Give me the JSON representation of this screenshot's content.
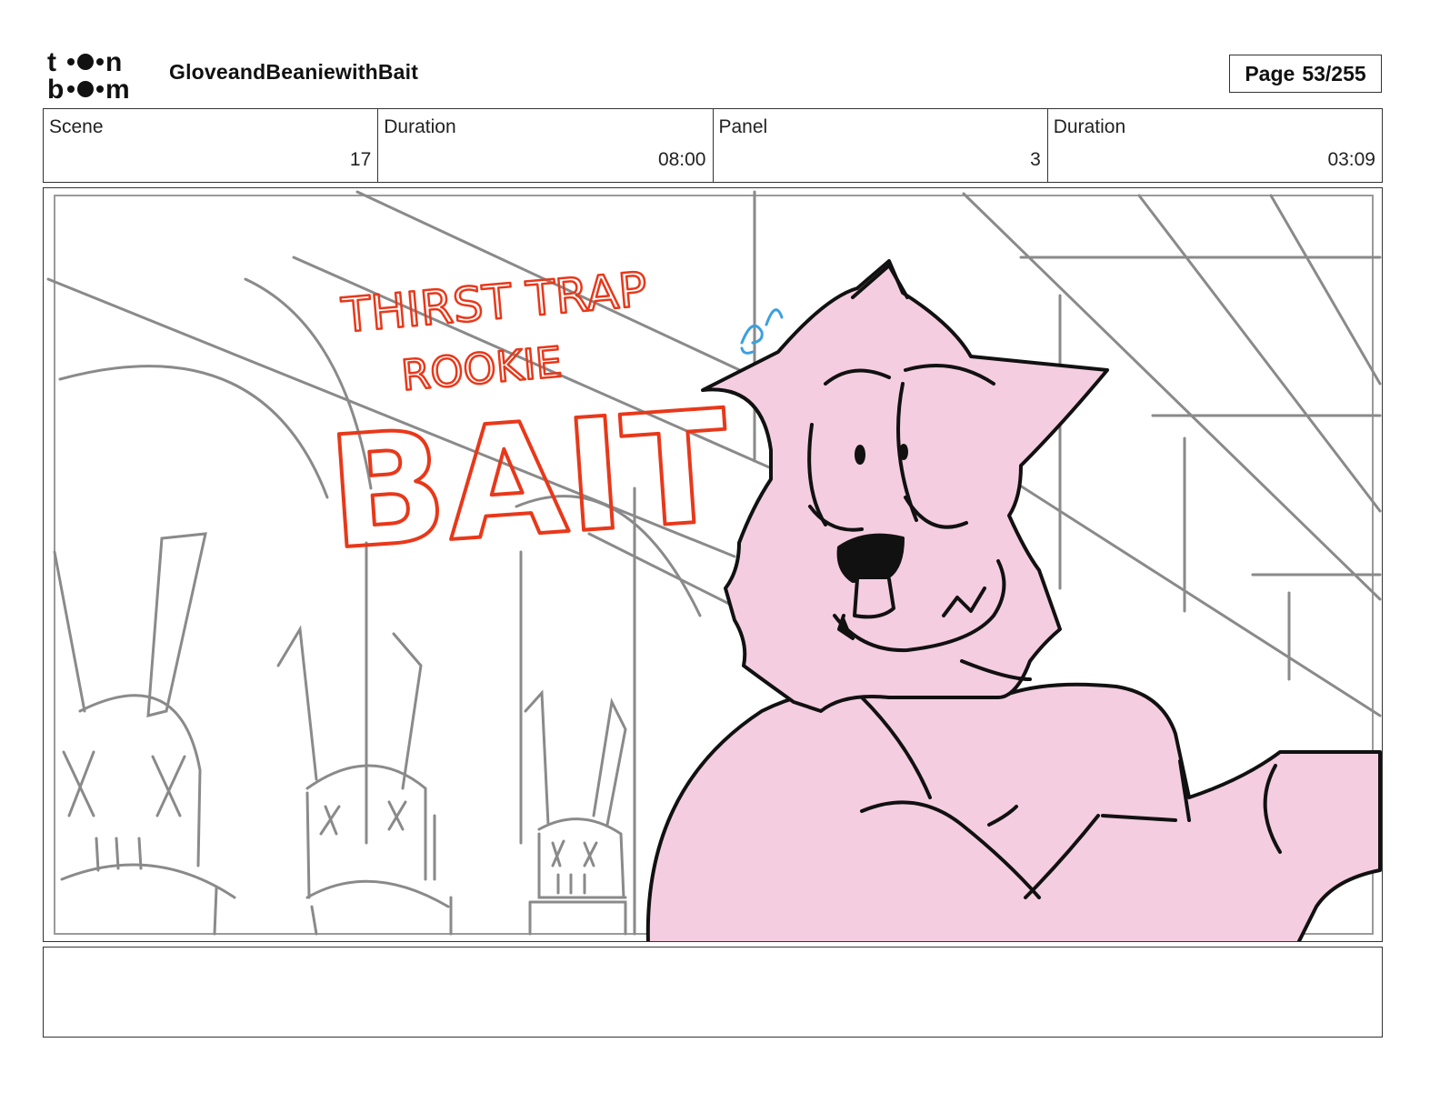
{
  "header": {
    "logo_text": "toon boom",
    "project_title": "GloveandBeaniewithBait",
    "page_label": "Page",
    "page_value": "53/255"
  },
  "info": [
    {
      "label": "Scene",
      "value": "17"
    },
    {
      "label": "Duration",
      "value": "08:00"
    },
    {
      "label": "Panel",
      "value": "3"
    },
    {
      "label": "Duration",
      "value": "03:09"
    }
  ],
  "panel": {
    "title_text": [
      "THIRST TRAP",
      "ROOKIE",
      "BAIT"
    ],
    "colors": {
      "sketch_lines": "#8a8a8a",
      "title_red": "#e8381a",
      "character_fill": "#f5cde0",
      "ink": "#111111",
      "sweat_blue": "#3aa0e0"
    }
  },
  "notes": {
    "text": ""
  }
}
